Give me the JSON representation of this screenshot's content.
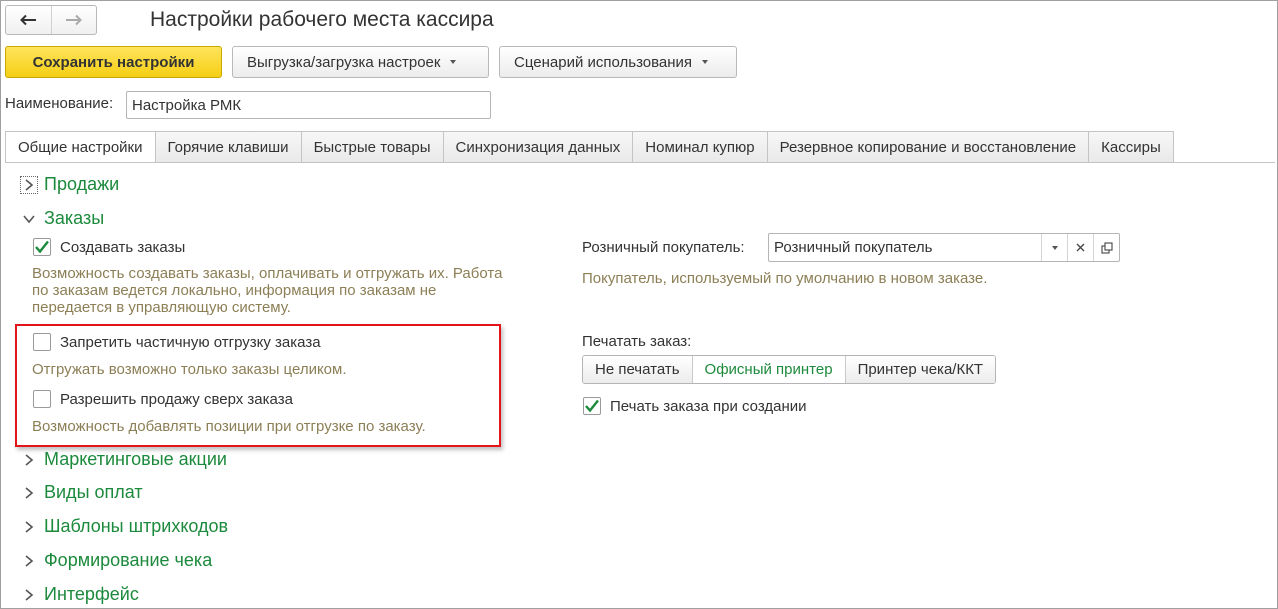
{
  "window": {
    "title": "Настройки рабочего места кассира"
  },
  "toolbar": {
    "save_label": "Сохранить настройки",
    "export_label": "Выгрузка/загрузка настроек",
    "scenario_label": "Сценарий использования"
  },
  "name_field": {
    "label": "Наименование:",
    "value": "Настройка РМК"
  },
  "tabs": [
    {
      "label": "Общие настройки",
      "active": true
    },
    {
      "label": "Горячие клавиши"
    },
    {
      "label": "Быстрые товары"
    },
    {
      "label": "Синхронизация данных"
    },
    {
      "label": "Номинал купюр"
    },
    {
      "label": "Резервное копирование и восстановление"
    },
    {
      "label": "Кассиры"
    }
  ],
  "sections": {
    "sales": {
      "label": "Продажи",
      "expanded": false
    },
    "orders": {
      "label": "Заказы",
      "expanded": true
    },
    "marketing": {
      "label": "Маркетинговые акции",
      "expanded": false
    },
    "payments": {
      "label": "Виды оплат",
      "expanded": false
    },
    "barcodes": {
      "label": "Шаблоны штрихкодов",
      "expanded": false
    },
    "receipt": {
      "label": "Формирование чека",
      "expanded": false
    },
    "interface": {
      "label": "Интерфейс",
      "expanded": false
    }
  },
  "orders": {
    "create_orders": {
      "label": "Создавать заказы",
      "checked": true,
      "hint": [
        "Возможность создавать заказы, оплачивать и отгружать их. Работа",
        "по заказам ведется локально, информация по заказам не",
        "передается в управляющую систему."
      ]
    },
    "forbid_partial": {
      "label": "Запретить частичную отгрузку заказа",
      "checked": false,
      "hint": "Отгружать возможно только заказы целиком."
    },
    "allow_over": {
      "label": "Разрешить продажу сверх заказа",
      "checked": false,
      "hint": "Возможность добавлять позиции при отгрузке по заказу."
    },
    "retail_customer": {
      "label": "Розничный покупатель:",
      "value": "Розничный покупатель",
      "hint": "Покупатель, используемый по умолчанию в новом заказе."
    },
    "print_order": {
      "label": "Печатать заказ:",
      "options": [
        "Не печатать",
        "Офисный принтер",
        "Принтер чека/ККТ"
      ],
      "selected": "Офисный принтер"
    },
    "print_on_create": {
      "label": "Печать заказа при создании",
      "checked": true
    }
  },
  "colors": {
    "accent_green": "#1c8a3c",
    "hint": "#8c7f56",
    "highlight_red": "#e3151a",
    "primary_yellow": "#f5cf14"
  },
  "icons": [
    "back-arrow-icon",
    "forward-arrow-icon",
    "dropdown-arrow-icon",
    "clear-icon",
    "open-icon",
    "checkmark-icon",
    "chevron-right-icon",
    "chevron-down-icon"
  ]
}
